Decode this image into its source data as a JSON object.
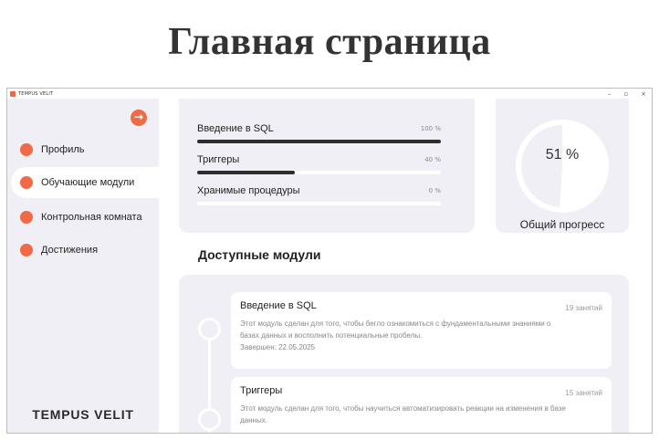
{
  "page_title": "Главная страница",
  "window": {
    "title": "TEMPUS VELIT",
    "controls": {
      "minimize": "–",
      "maximize": "▫",
      "close": "×"
    }
  },
  "sidebar": {
    "toggle_icon": "arrow-right-icon",
    "items": [
      {
        "label": "Профиль",
        "active": false
      },
      {
        "label": "Обучающие модули",
        "active": true
      },
      {
        "label": "Контрольная комната",
        "active": false
      },
      {
        "label": "Достижения",
        "active": false
      }
    ],
    "brand": "TEMPUS VELIT",
    "accent_color": "#f06a45"
  },
  "progress": {
    "items": [
      {
        "label": "Введение в SQL",
        "percent_text": "100 %",
        "value": 1.0
      },
      {
        "label": "Триггеры",
        "percent_text": "40 %",
        "value": 0.4
      },
      {
        "label": "Хранимые процедуры",
        "percent_text": "0 %",
        "value": 0.0
      }
    ]
  },
  "overall": {
    "percent_text": "51 %",
    "value": 0.51,
    "label": "Общий прогресс"
  },
  "modules": {
    "title": "Доступные модули",
    "items": [
      {
        "title": "Введение в SQL",
        "lessons": "19 занятий",
        "description": "Этот модуль сделан для того, чтобы бегло ознакомиться с фундаментальными знаниями о базах данных и восполнить потенциальные пробелы.",
        "completed": "Завершен: 22.05.2025"
      },
      {
        "title": "Триггеры",
        "lessons": "15 занятий",
        "description": "Этот модуль сделан для того, чтобы научиться автоматизировать реакции на изменения в базе данных."
      }
    ]
  }
}
